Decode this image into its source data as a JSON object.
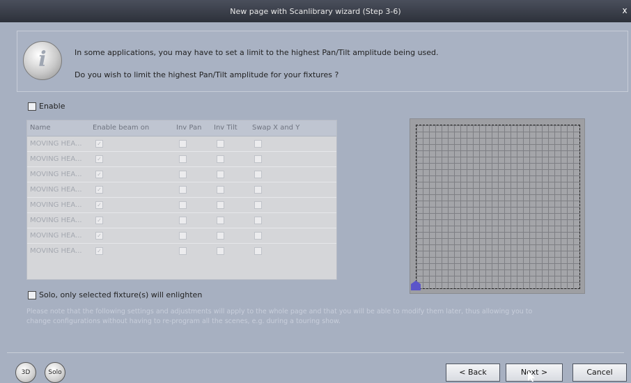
{
  "window": {
    "title": "New page with Scanlibrary wizard (Step 3-6)",
    "close_label": "x"
  },
  "banner": {
    "icon_letter": "i",
    "line1": "In some applications, you may have to set a limit to the highest Pan/Tilt amplitude being used.",
    "line2": "Do you wish to limit the highest Pan/Tilt amplitude for your fixtures ?"
  },
  "enable": {
    "label": "Enable",
    "checked": false
  },
  "table": {
    "columns": [
      "Name",
      "Enable beam on",
      "Inv Pan",
      "Inv Tilt",
      "Swap X and Y"
    ],
    "rows": [
      {
        "name": "MOVING HEA...",
        "enable_beam": true,
        "inv_pan": false,
        "inv_tilt": false,
        "swap": false
      },
      {
        "name": "MOVING HEA...",
        "enable_beam": true,
        "inv_pan": false,
        "inv_tilt": false,
        "swap": false
      },
      {
        "name": "MOVING HEA...",
        "enable_beam": true,
        "inv_pan": false,
        "inv_tilt": false,
        "swap": false
      },
      {
        "name": "MOVING HEA...",
        "enable_beam": true,
        "inv_pan": false,
        "inv_tilt": false,
        "swap": false
      },
      {
        "name": "MOVING HEA...",
        "enable_beam": true,
        "inv_pan": false,
        "inv_tilt": false,
        "swap": false
      },
      {
        "name": "MOVING HEA...",
        "enable_beam": true,
        "inv_pan": false,
        "inv_tilt": false,
        "swap": false
      },
      {
        "name": "MOVING HEA...",
        "enable_beam": true,
        "inv_pan": false,
        "inv_tilt": false,
        "swap": false
      },
      {
        "name": "MOVING HEA...",
        "enable_beam": true,
        "inv_pan": false,
        "inv_tilt": false,
        "swap": false
      }
    ]
  },
  "solo": {
    "label": "Solo, only selected fixture(s) will enlighten",
    "checked": false
  },
  "note": {
    "line1": "Please note that the following settings and adjustments will apply to the whole page and that you will be able to modify them later, thus allowing you to",
    "line2": "change configurations without having to re-program all the scenes, e.g. during a touring show."
  },
  "bottom": {
    "btn_3d": "3D",
    "btn_solo": "Solo",
    "back": "< Back",
    "next": "Next >",
    "cancel": "Cancel"
  },
  "colors": {
    "background": "#a7b0c1",
    "handle": "#5b55c9"
  }
}
